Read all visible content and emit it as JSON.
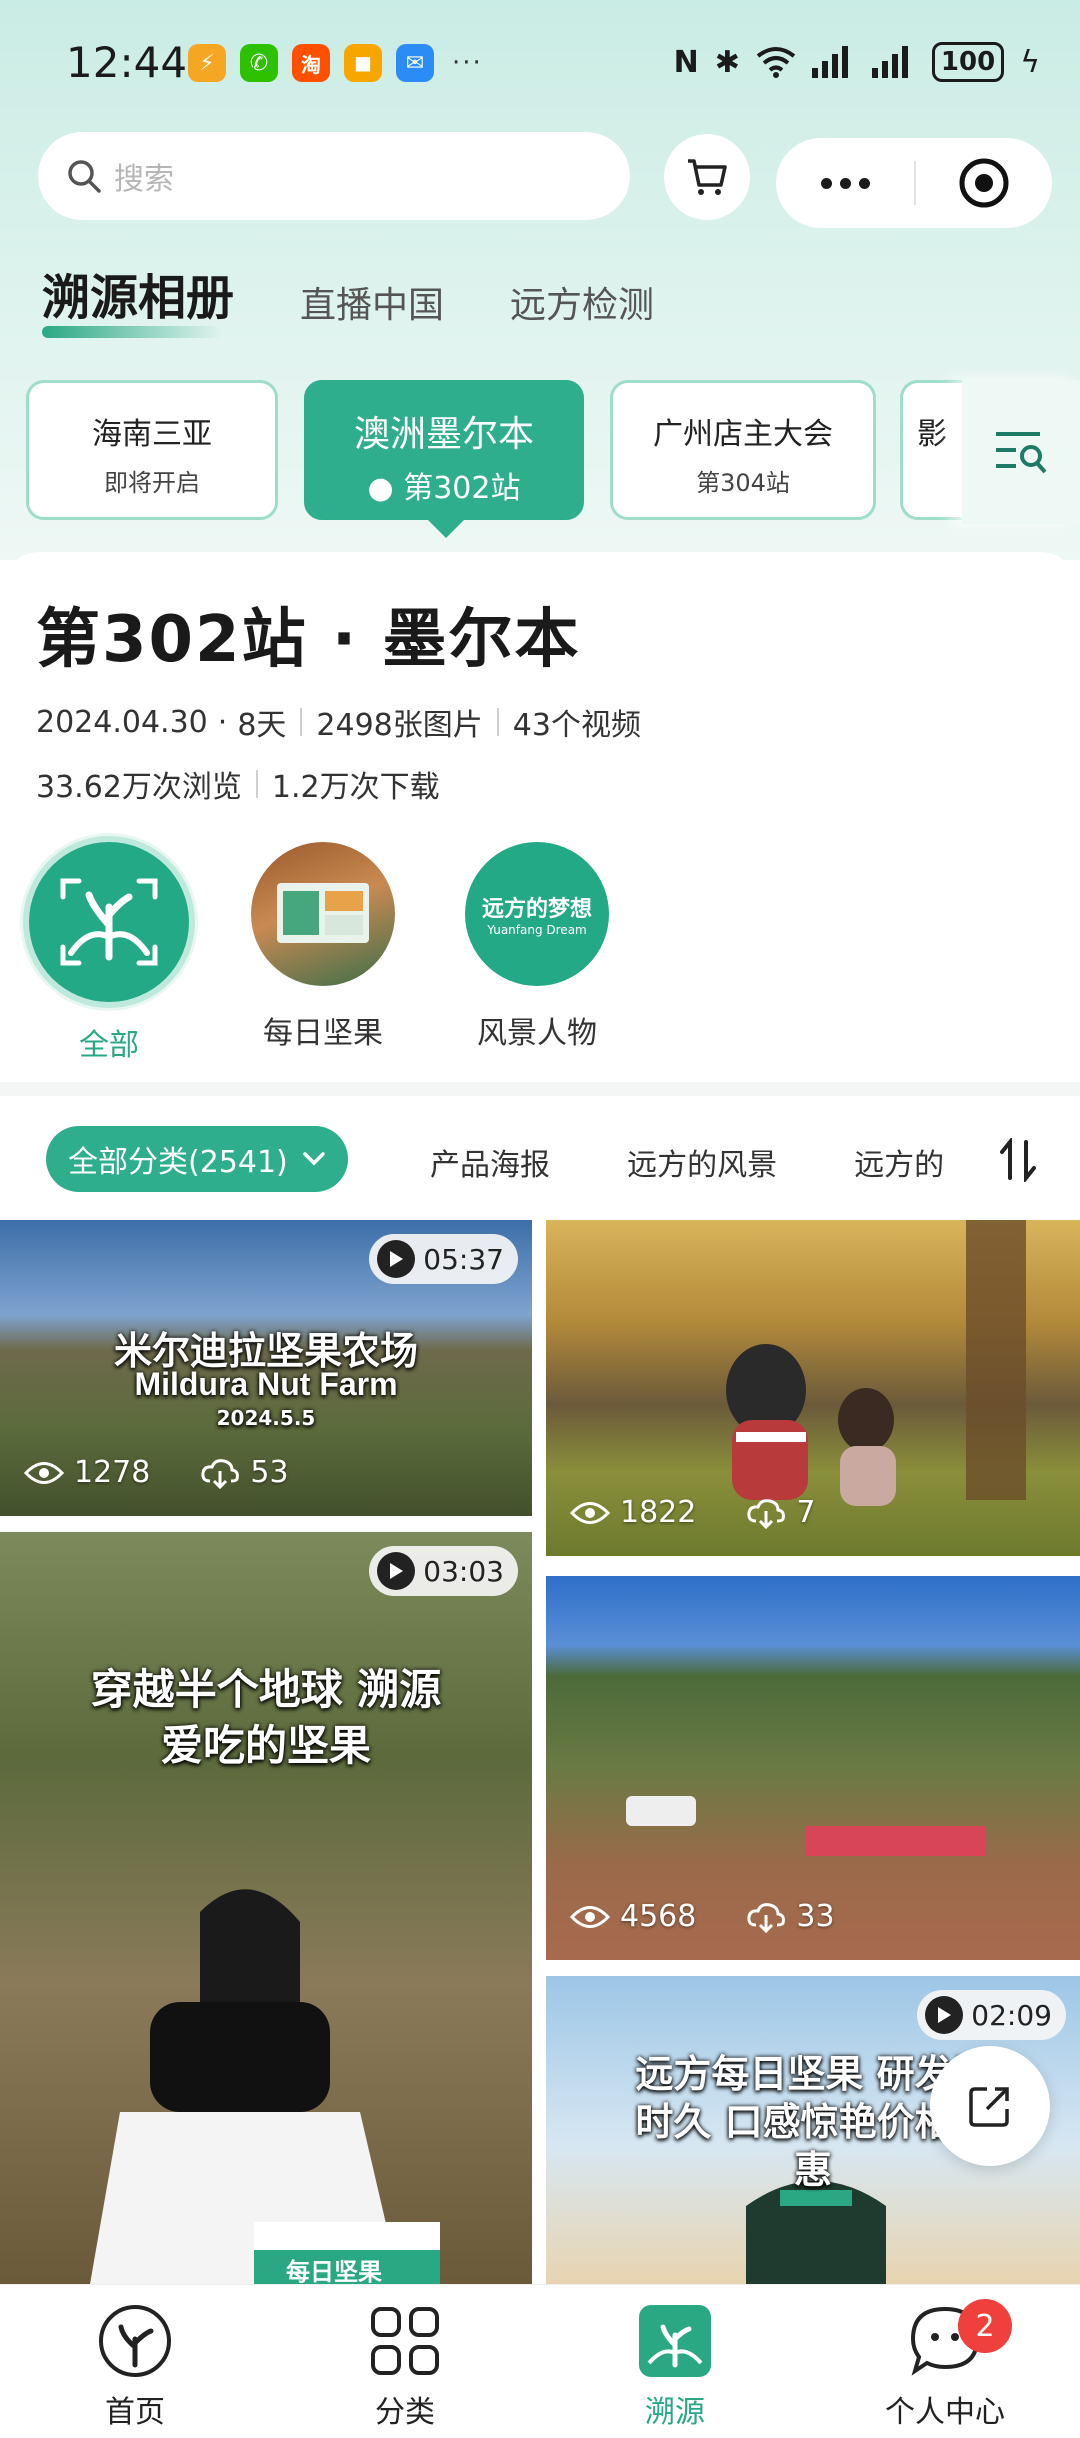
{
  "status_bar": {
    "time": "12:44",
    "battery": "100",
    "more": "···",
    "app_icons": [
      {
        "name": "app-icon-orange",
        "glyph": "⚡",
        "color": "#f5a623"
      },
      {
        "name": "wechat-icon",
        "glyph": "✆",
        "color": "#2dc100"
      },
      {
        "name": "taobao-icon",
        "glyph": "淘",
        "color": "#ff5000"
      },
      {
        "name": "app-icon-yellow",
        "glyph": "◼",
        "color": "#f7a600"
      },
      {
        "name": "message-icon",
        "glyph": "✉",
        "color": "#2b8cf6"
      }
    ]
  },
  "search": {
    "placeholder": "搜索"
  },
  "top_tabs": [
    {
      "label": "溯源相册",
      "active": true
    },
    {
      "label": "直播中国",
      "active": false
    },
    {
      "label": "远方检测",
      "active": false
    }
  ],
  "stations": [
    {
      "name": "海南三亚",
      "sub": "即将开启",
      "active": false
    },
    {
      "name": "澳洲墨尔本",
      "sub": "第302站",
      "active": true
    },
    {
      "name": "广州店主大会",
      "sub": "第304站",
      "active": false
    },
    {
      "name": "影",
      "sub": "",
      "active": false
    }
  ],
  "station_info": {
    "title": "第302站 · 墨尔本",
    "date": "2024.04.30",
    "days": "8天",
    "photos": "2498张图片",
    "videos": "43个视频",
    "views": "33.62万次浏览",
    "downloads": "1.2万次下载"
  },
  "albums": [
    {
      "label": "全部",
      "active": true
    },
    {
      "label": "每日坚果",
      "active": false
    },
    {
      "label": "风景人物",
      "active": false
    }
  ],
  "album_logo_text": "远方的梦想",
  "album_logo_sub": "Yuanfang Dream",
  "categories": {
    "all_label": "全部分类(2541)",
    "items": [
      "产品海报",
      "远方的风景",
      "远方的"
    ]
  },
  "gallery": [
    {
      "duration": "05:37",
      "views": "1278",
      "downloads": "53",
      "title_cn": "米尔迪拉坚果农场",
      "title_en": "Mildura Nut Farm",
      "date": "2024.5.5"
    },
    {
      "duration": "",
      "views": "1822",
      "downloads": "7"
    },
    {
      "duration": "03:03",
      "views": "",
      "downloads": "",
      "title_cn": "穿越半个地球 溯源爱吃的坚果",
      "box_label": "每日坚果"
    },
    {
      "duration": "",
      "views": "4568",
      "downloads": "33"
    },
    {
      "duration": "02:09",
      "views": "",
      "downloads": "",
      "title_cn": "远方每日坚果 研发历时久 口感惊艳价格优惠"
    }
  ],
  "bottom_nav": [
    {
      "label": "首页",
      "active": false
    },
    {
      "label": "分类",
      "active": false
    },
    {
      "label": "溯源",
      "active": true
    },
    {
      "label": "个人中心",
      "active": false,
      "badge": "2"
    }
  ],
  "colors": {
    "accent": "#2fae8e",
    "badge": "#f0403c"
  }
}
